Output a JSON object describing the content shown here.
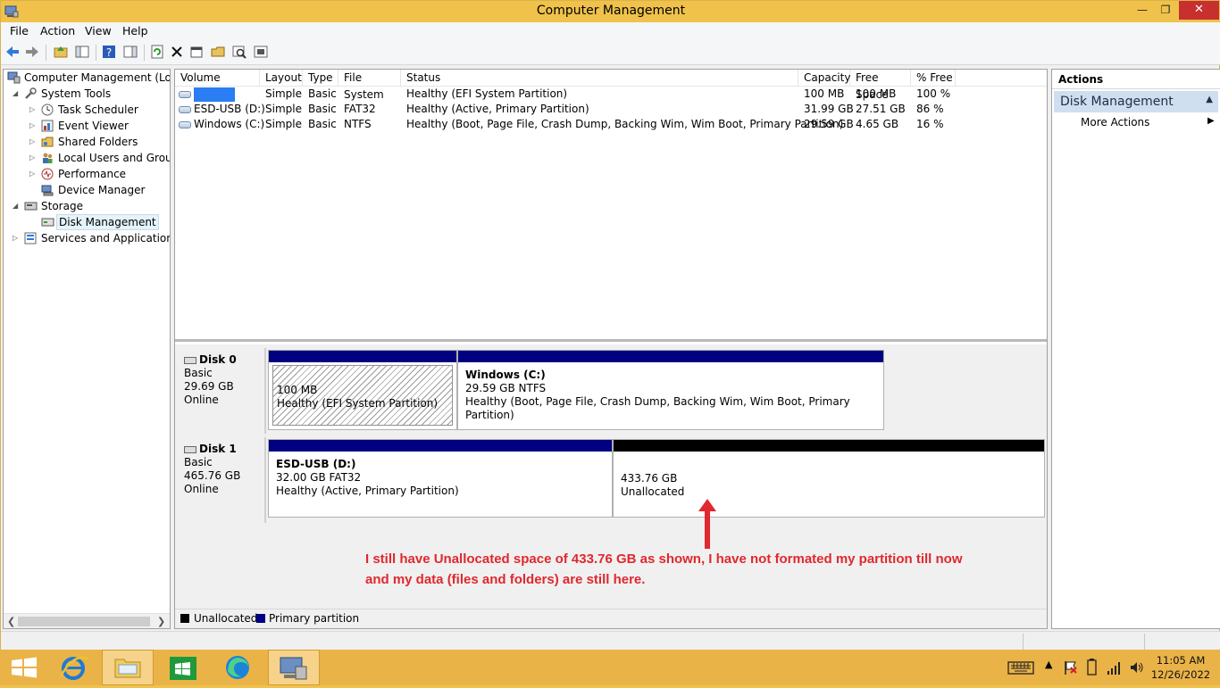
{
  "window": {
    "title": "Computer Management"
  },
  "menu": [
    "File",
    "Action",
    "View",
    "Help"
  ],
  "tree": {
    "root": "Computer Management (Local",
    "system_tools": "System Tools",
    "task_scheduler": "Task Scheduler",
    "event_viewer": "Event Viewer",
    "shared_folders": "Shared Folders",
    "local_users": "Local Users and Groups",
    "performance": "Performance",
    "device_manager": "Device Manager",
    "storage": "Storage",
    "disk_management": "Disk Management",
    "services": "Services and Applications"
  },
  "volumes": {
    "headers": [
      "Volume",
      "Layout",
      "Type",
      "File System",
      "Status",
      "Capacity",
      "Free Space",
      "% Free"
    ],
    "rows": [
      {
        "volume": "",
        "layout": "Simple",
        "type": "Basic",
        "fs": "",
        "status": "Healthy (EFI System Partition)",
        "capacity": "100 MB",
        "free": "100 MB",
        "pct": "100 %"
      },
      {
        "volume": "ESD-USB (D:)",
        "layout": "Simple",
        "type": "Basic",
        "fs": "FAT32",
        "status": "Healthy (Active, Primary Partition)",
        "capacity": "31.99 GB",
        "free": "27.51 GB",
        "pct": "86 %"
      },
      {
        "volume": "Windows (C:)",
        "layout": "Simple",
        "type": "Basic",
        "fs": "NTFS",
        "status": "Healthy (Boot, Page File, Crash Dump, Backing Wim, Wim Boot, Primary Partition)",
        "capacity": "29.59 GB",
        "free": "4.65 GB",
        "pct": "16 %"
      }
    ]
  },
  "disks": [
    {
      "name": "Disk 0",
      "type": "Basic",
      "size": "29.69 GB",
      "state": "Online",
      "partitions": [
        {
          "name": "",
          "size": "100 MB",
          "status": "Healthy (EFI System Partition)"
        },
        {
          "name": "Windows  (C:)",
          "size": "29.59 GB NTFS",
          "status": "Healthy (Boot, Page File, Crash Dump, Backing Wim, Wim Boot, Primary Partition)"
        }
      ]
    },
    {
      "name": "Disk 1",
      "type": "Basic",
      "size": "465.76 GB",
      "state": "Online",
      "partitions": [
        {
          "name": "ESD-USB  (D:)",
          "size": "32.00 GB FAT32",
          "status": "Healthy (Active, Primary Partition)"
        },
        {
          "name": "",
          "size": "433.76 GB",
          "status": "Unallocated"
        }
      ]
    }
  ],
  "legend": {
    "unallocated": "Unallocated",
    "primary": "Primary partition",
    "unallocated_color": "#000000",
    "primary_color": "#000080"
  },
  "annotation": {
    "line1": "I still have Unallocated space of 433.76 GB as shown, I have not formated my partition till now",
    "line2": "and my data (files and folders) are still here.",
    "color": "#e0282e"
  },
  "actions": {
    "header": "Actions",
    "section": "Disk Management",
    "more": "More Actions"
  },
  "clock": {
    "time": "11:05 AM",
    "date": "12/26/2022"
  },
  "colors": {
    "titlebar": "#f0c24b",
    "taskbar": "#eab347",
    "close": "#c7302e",
    "selection": "#e5f3fb"
  }
}
